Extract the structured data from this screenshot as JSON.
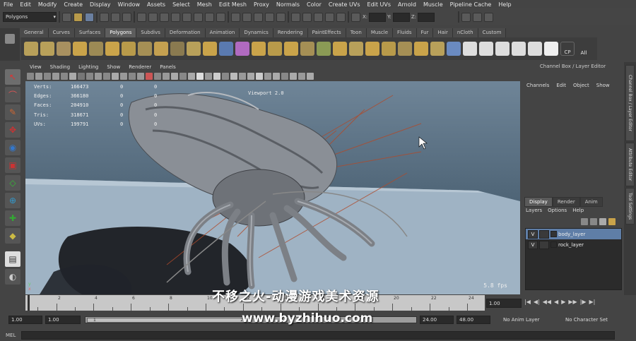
{
  "menubar": [
    "File",
    "Edit",
    "Modify",
    "Create",
    "Display",
    "Window",
    "Assets",
    "Select",
    "Mesh",
    "Edit Mesh",
    "Proxy",
    "Normals",
    "Color",
    "Create UVs",
    "Edit UVs",
    "Arnold",
    "Muscle",
    "Pipeline Cache",
    "Help"
  ],
  "status": {
    "mode": "Polygons",
    "x_label": "X:",
    "y_label": "Y:",
    "z_label": "Z:"
  },
  "shelf_tabs": [
    "General",
    "Curves",
    "Surfaces",
    "Polygons",
    "Subdivs",
    "Deformation",
    "Animation",
    "Dynamics",
    "Rendering",
    "PaintEffects",
    "Toon",
    "Muscle",
    "Fluids",
    "Fur",
    "Hair",
    "nCloth",
    "Custom"
  ],
  "shelf_active": "Polygons",
  "shelf_extra": {
    "cp": "CP",
    "all": "All"
  },
  "viewport_menu": [
    "View",
    "Shading",
    "Lighting",
    "Show",
    "Renderer",
    "Panels"
  ],
  "hud": [
    {
      "label": "Verts:",
      "value": "166473",
      "a": "0",
      "b": "0"
    },
    {
      "label": "Edges:",
      "value": "366180",
      "a": "0",
      "b": "0"
    },
    {
      "label": "Faces:",
      "value": "204910",
      "a": "0",
      "b": "0"
    },
    {
      "label": "Tris:",
      "value": "318671",
      "a": "0",
      "b": "0"
    },
    {
      "label": "UVs:",
      "value": "199791",
      "a": "0",
      "b": "0"
    }
  ],
  "viewport_title": "Viewport 2.0",
  "fps": "5.8 fps",
  "axis": {
    "x": "x",
    "y": "y"
  },
  "right_panel": {
    "title": "Channel Box / Layer Editor",
    "channel_menu": [
      "Channels",
      "Edit",
      "Object",
      "Show"
    ],
    "layer_tabs": [
      "Display",
      "Render",
      "Anim"
    ],
    "layer_menu": [
      "Layers",
      "Options",
      "Help"
    ],
    "layers": [
      {
        "v": "V",
        "name": "body_layer"
      },
      {
        "v": "V",
        "name": "rock_layer"
      }
    ],
    "vertical_tabs": [
      "Channel Box / Layer Editor",
      "Attribute Editor",
      "Tool Settings"
    ]
  },
  "timeline": {
    "ticks": [
      "2",
      "4",
      "6",
      "8",
      "10",
      "12",
      "14",
      "16",
      "18",
      "20",
      "22",
      "24"
    ],
    "current": "1.00"
  },
  "range": {
    "start": "1.00",
    "start2": "1.00",
    "handle_start": "1",
    "handle_end": "24",
    "end": "24.00",
    "end2": "48.00",
    "anim_layer": "No Anim Layer",
    "character": "No Character Set"
  },
  "cmd_label": "MEL",
  "watermark": {
    "line1": "不移之火-动漫游戏美术资源",
    "line2": "www.byzhihuo.com"
  }
}
